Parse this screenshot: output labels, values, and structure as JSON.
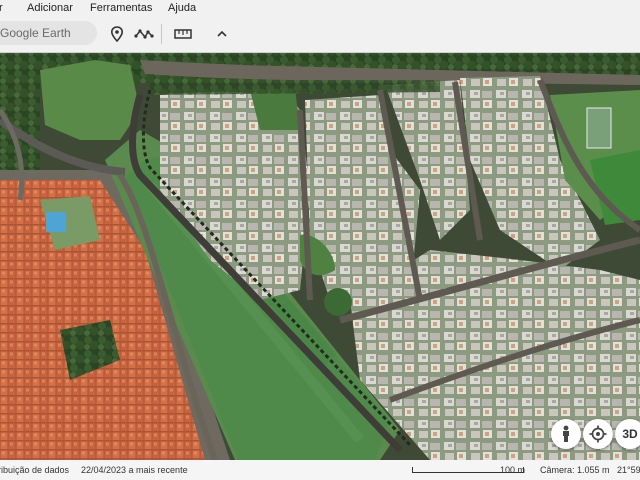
{
  "menu": {
    "items": [
      {
        "label": "r"
      },
      {
        "label": "Adicionar"
      },
      {
        "label": "Ferramentas"
      },
      {
        "label": "Ajuda"
      }
    ]
  },
  "toolbar": {
    "search_placeholder": "Google Earth",
    "icons": [
      "place-marker-icon",
      "path-icon",
      "ruler-icon",
      "collapse-chevron-icon"
    ]
  },
  "map": {
    "view": "satellite",
    "buttons": {
      "streetview_icon": "pegman-icon",
      "location_icon": "crosshair-icon",
      "mode_3d_label": "3D"
    }
  },
  "status": {
    "attribution": "ribuição de dados",
    "imagery_date": "22/04/2023 a mais recente",
    "scale_label": "100 m",
    "camera": "Câmera: 1.055 m",
    "coords": "21°59"
  },
  "colors": {
    "toolbar_bg": "#f1f1f1",
    "statusbar_bg": "#f5f5f5",
    "field_green": "#4f8a4a",
    "roof_orange": "#cf6c44",
    "roof_grey": "#c8c8c4",
    "tree_green": "#2b4a24"
  }
}
